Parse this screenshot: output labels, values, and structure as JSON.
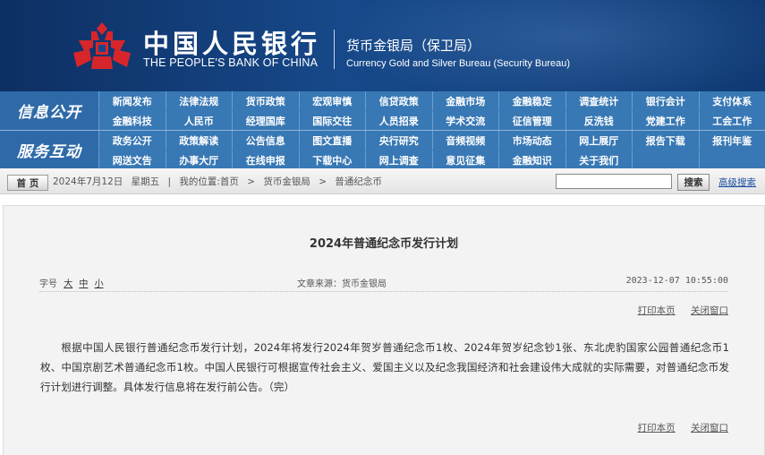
{
  "header": {
    "bank_name_cn": "中国人民银行",
    "bank_name_en": "THE PEOPLE'S BANK OF CHINA",
    "dept_cn": "货币金银局（保卫局）",
    "dept_en": "Currency Gold and Silver Bureau (Security Bureau)",
    "logo_icon": "pboc-emblem-icon",
    "colors": {
      "banner": "#17498a",
      "logo": "#d7262b",
      "nav": "#3878b4"
    }
  },
  "nav": {
    "sections": [
      {
        "label": "信息公开",
        "items": [
          "新闻发布",
          "法律法规",
          "货币政策",
          "宏观审慎",
          "信贷政策",
          "金融市场",
          "金融稳定",
          "调查统计",
          "银行会计",
          "支付体系",
          "金融科技",
          "人民币",
          "经理国库",
          "国际交往",
          "人员招录",
          "学术交流",
          "征信管理",
          "反洗钱",
          "党建工作",
          "工会工作"
        ]
      },
      {
        "label": "服务互动",
        "items": [
          "政务公开",
          "政策解读",
          "公告信息",
          "图文直播",
          "央行研究",
          "音频视频",
          "市场动态",
          "网上展厅",
          "报告下载",
          "报刊年鉴",
          "网送文告",
          "办事大厅",
          "在线申报",
          "下载中心",
          "网上调查",
          "意见征集",
          "金融知识",
          "关于我们",
          "",
          ""
        ]
      }
    ]
  },
  "breadcrumb": {
    "home_button": "首 页",
    "date": "2024年7月12日",
    "weekday": "星期五",
    "separator": "|",
    "location_label": "我的位置:",
    "items": [
      "首页",
      ">",
      "货币金银局",
      ">",
      "普通纪念币"
    ]
  },
  "search": {
    "placeholder": "",
    "button": "搜索",
    "advanced": "高级搜索"
  },
  "article": {
    "title": "2024年普通纪念币发行计划",
    "font_size_label": "字号",
    "font_sizes": [
      "大",
      "中",
      "小"
    ],
    "source": "文章来源：货币金银局",
    "datetime": "2023-12-07  10:55:00",
    "print": "打印本页",
    "close": "关闭窗口",
    "body": "根据中国人民银行普通纪念币发行计划，2024年将发行2024年贺岁普通纪念币1枚、2024年贺岁纪念钞1张、东北虎豹国家公园普通纪念币1枚、中国京剧艺术普通纪念币1枚。中国人民银行可根据宣传社会主义、爱国主义以及纪念我国经济和社会建设伟大成就的实际需要，对普通纪念币发行计划进行调整。具体发行信息将在发行前公告。（完）"
  }
}
